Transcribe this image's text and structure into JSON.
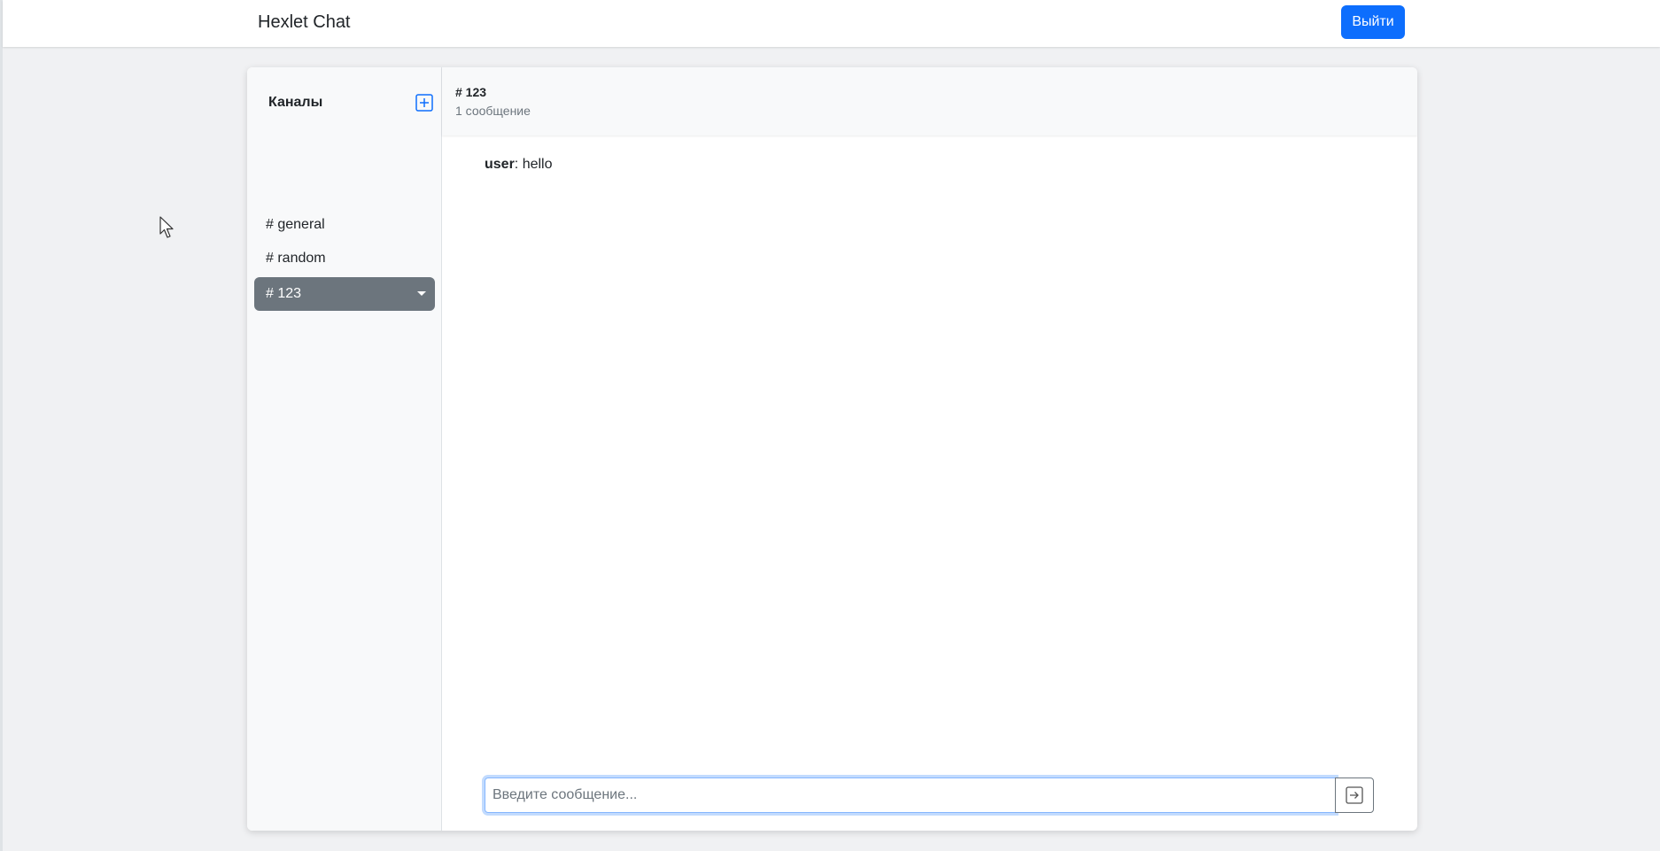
{
  "navbar": {
    "brand": "Hexlet Chat",
    "logout_label": "Выйти"
  },
  "sidebar": {
    "title": "Каналы",
    "add_channel_icon": "plus-square-icon",
    "channels": [
      {
        "label": "# general",
        "active": false
      },
      {
        "label": "# random",
        "active": false
      },
      {
        "label": "# 123",
        "active": true
      }
    ]
  },
  "chat": {
    "channel_name": "# 123",
    "message_count": "1 сообщение",
    "messages": [
      {
        "author": "user",
        "separator": ": ",
        "text": "hello"
      }
    ],
    "input": {
      "value": "",
      "placeholder": "Введите сообщение..."
    },
    "send_icon": "arrow-right-square-icon"
  },
  "colors": {
    "accent": "#0d6efd",
    "active_channel": "#6c757d",
    "panel_background": "#f8f9fa"
  }
}
